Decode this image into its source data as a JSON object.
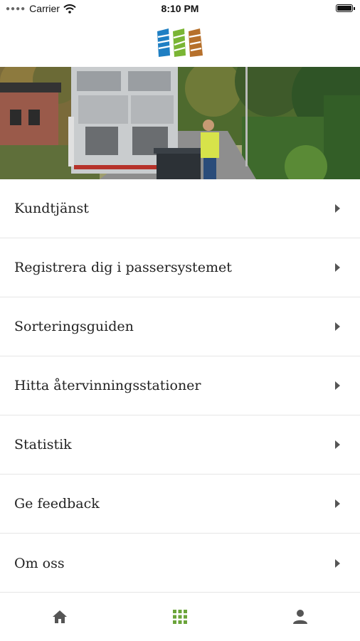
{
  "status_bar": {
    "carrier": "Carrier",
    "time": "8:10 PM"
  },
  "menu": {
    "items": [
      {
        "label": "Kundtjänst"
      },
      {
        "label": "Registrera dig i passersystemet"
      },
      {
        "label": "Sorteringsguiden"
      },
      {
        "label": "Hitta återvinningsstationer"
      },
      {
        "label": "Statistik"
      },
      {
        "label": "Ge feedback"
      },
      {
        "label": "Om oss"
      }
    ]
  },
  "tabbar": {
    "tabs": [
      {
        "icon": "home-icon",
        "active": false
      },
      {
        "icon": "grid-icon",
        "active": true,
        "color": "#6ba43a"
      },
      {
        "icon": "person-icon",
        "active": false
      }
    ]
  },
  "colors": {
    "logo_blue": "#1f7fc3",
    "logo_green": "#7ab534",
    "logo_brown": "#b6702b"
  }
}
